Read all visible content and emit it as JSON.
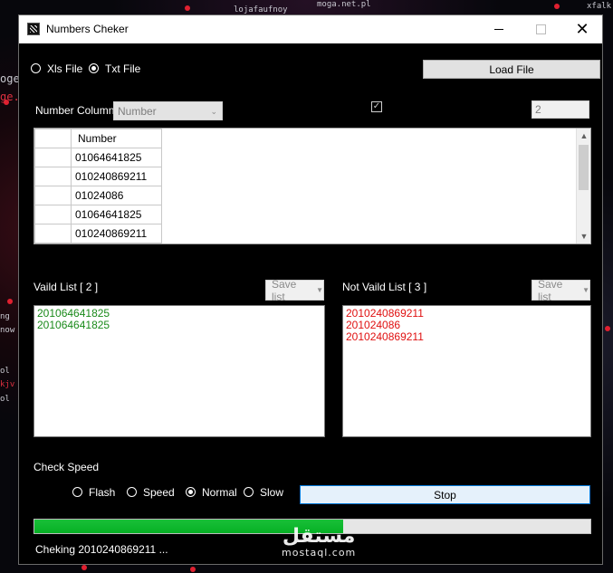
{
  "window": {
    "title": "Numbers Cheker",
    "close_glyph": "✕"
  },
  "source": {
    "xls_label": "Xls File",
    "txt_label": "Txt File",
    "selected": "txt",
    "load_button": "Load File"
  },
  "column": {
    "label": "Number Column",
    "selected": "Number",
    "checkbox_checked": true,
    "count_value": "2"
  },
  "grid": {
    "header": "Number",
    "rows": [
      "01064641825",
      "010240869211",
      "01024086",
      "01064641825",
      "010240869211"
    ]
  },
  "valid": {
    "label": "Vaild List [ 2 ]",
    "save_label": "Save list",
    "items": [
      "201064641825",
      "201064641825"
    ]
  },
  "invalid": {
    "label": "Not Vaild List [ 3 ]",
    "save_label": "Save list",
    "items": [
      "2010240869211",
      "201024086",
      "2010240869211"
    ]
  },
  "speed": {
    "label": "Check Speed",
    "options": [
      "Flash",
      "Speed",
      "Normal",
      "Slow"
    ],
    "selected": "Normal",
    "stop_button": "Stop"
  },
  "progress": {
    "fraction": 0.555
  },
  "status": "Cheking 2010240869211 ...",
  "watermark": {
    "arabic": "مستقل",
    "latin": "mostaql.com"
  },
  "background_texts": [
    "lojafaufnoy",
    "moga.net.pl",
    "xfalk",
    "oge",
    "ge.bi",
    "ng",
    "now",
    "ol",
    "kjv",
    "ol"
  ],
  "colors": {
    "valid": "#1a8a1a",
    "invalid": "#e01010",
    "progress": "#06b025"
  },
  "icons": {
    "app": "app-icon",
    "minimize": "minimize-icon",
    "maximize": "maximize-icon",
    "close": "close-icon",
    "dropdown": "chevron-down-icon"
  }
}
